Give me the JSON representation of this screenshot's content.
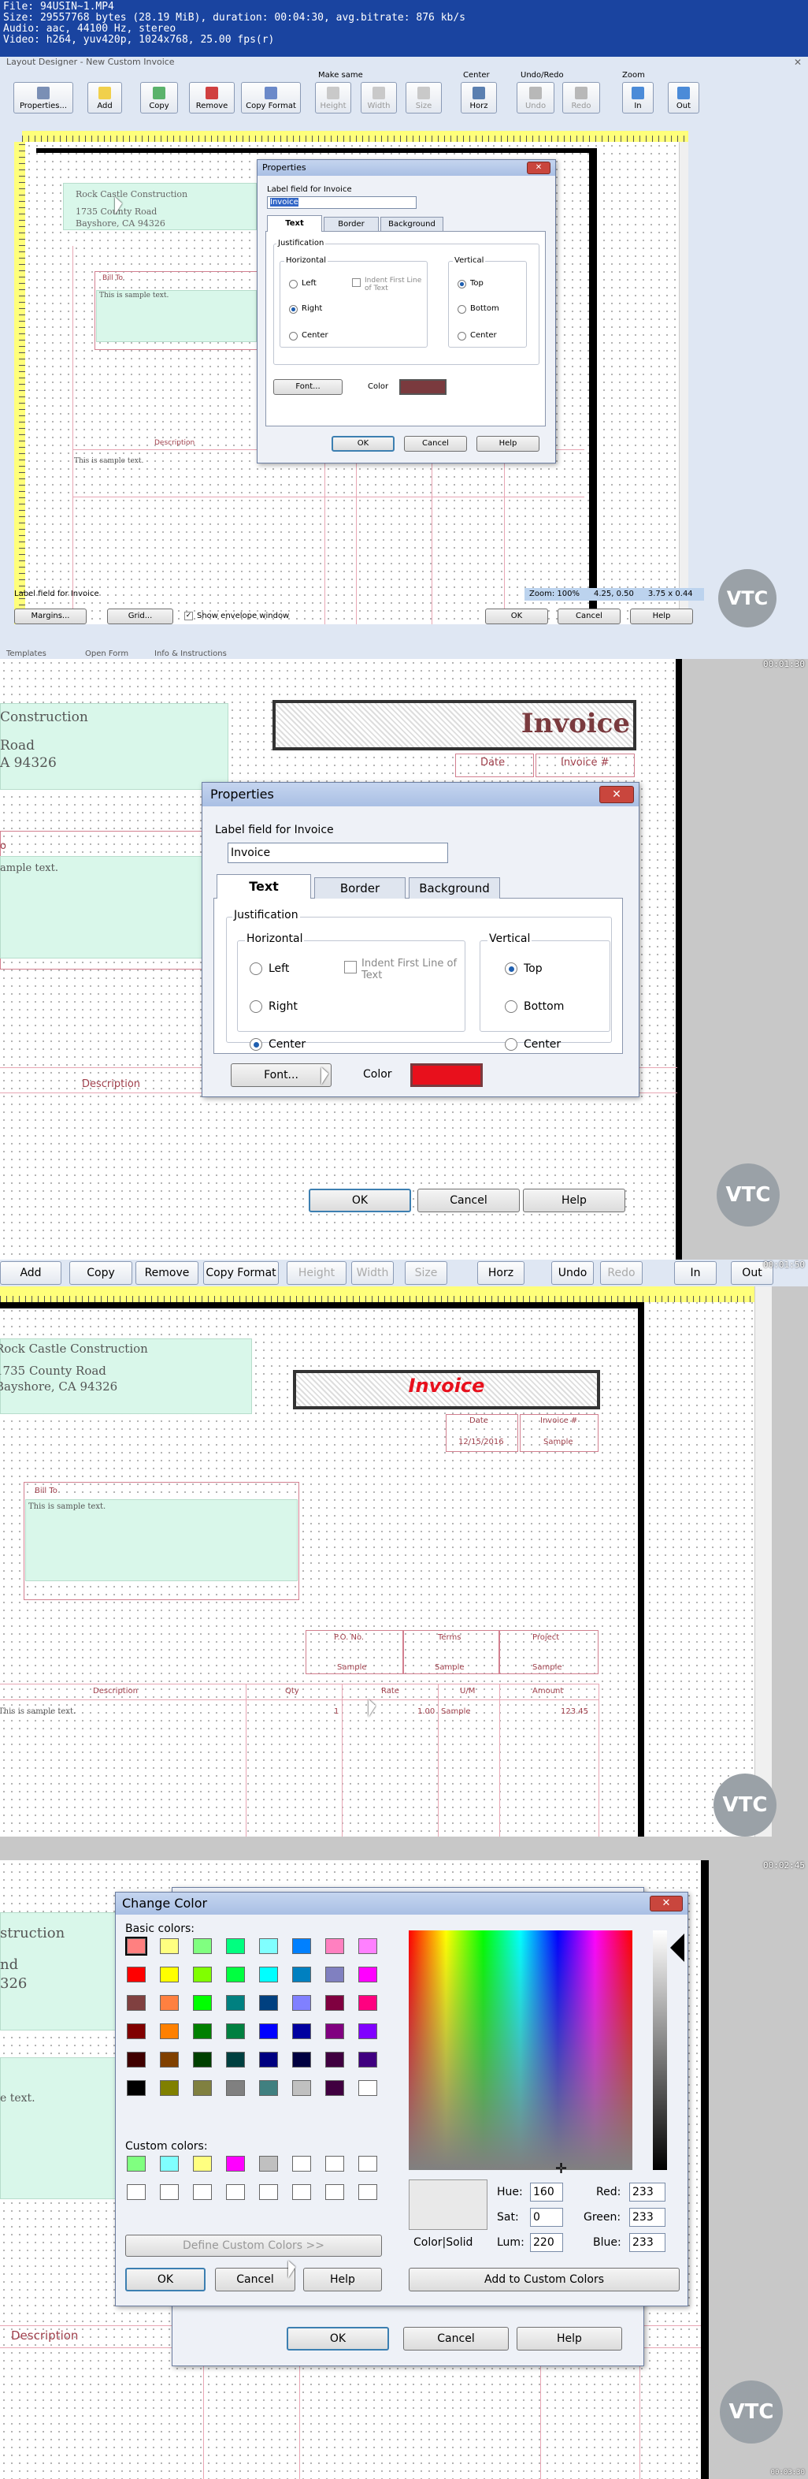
{
  "meta": {
    "line1": "File: 94USIN~1.MP4",
    "line2": "Size: 29557768 bytes (28.19 MiB), duration: 00:04:30, avg.bitrate: 876 kb/s",
    "line3": "Audio: aac, 44100 Hz, stereo",
    "line4": "Video: h264, yuv420p, 1024x768, 25.00 fps(r)"
  },
  "window_title": "Layout Designer - New Custom Invoice",
  "toolbar": {
    "properties": "Properties...",
    "add": "Add",
    "copy": "Copy",
    "remove": "Remove",
    "copy_format": "Copy Format",
    "make_same": "Make same",
    "height": "Height",
    "width": "Width",
    "size": "Size",
    "center": "Center",
    "horz": "Horz",
    "undo_redo": "Undo/Redo",
    "undo": "Undo",
    "redo": "Redo",
    "zoom": "Zoom",
    "in": "In",
    "out": "Out"
  },
  "company": {
    "name": "Rock Castle Construction",
    "addr1": "1735 County Road",
    "addr2": "Bayshore, CA 94326"
  },
  "company_cropped": {
    "name": "Construction",
    "addr1": "Road",
    "addr2": "A 94326",
    "addr1_b": "nd",
    "addr2_b": "326",
    "name_b": "struction"
  },
  "invoice_title": "Invoice",
  "bill_to": "Bill To",
  "bill_to_cropped": "o",
  "sample_text": "This is sample text.",
  "sample_text_cropped": "ample text.",
  "sample_text_cropped_b": "e text.",
  "description": "Description",
  "date": "Date",
  "invoice_num": "Invoice #",
  "status": {
    "label": "Label field for Invoice",
    "zoom": "Zoom: 100%",
    "pos": "4.25, 0.50",
    "size": "3.75 x 0.44"
  },
  "bottom_buttons": {
    "margins": "Margins...",
    "grid": "Grid...",
    "envelope": "Show envelope window",
    "ok": "OK",
    "cancel": "Cancel",
    "help": "Help"
  },
  "props": {
    "title": "Properties",
    "label_field": "Label field for Invoice",
    "value": "Invoice",
    "tab_text": "Text",
    "tab_border": "Border",
    "tab_background": "Background",
    "justification": "Justification",
    "horizontal": "Horizontal",
    "vertical": "Vertical",
    "left": "Left",
    "right": "Right",
    "center": "Center",
    "indent": "Indent First Line of Text",
    "top": "Top",
    "bottom": "Bottom",
    "font": "Font...",
    "color": "Color",
    "ok": "OK",
    "cancel": "Cancel",
    "help": "Help"
  },
  "frame3": {
    "date_val": "12/15/2016",
    "sample": "Sample",
    "po": "P.O. No.",
    "terms": "Terms",
    "project": "Project",
    "qty": "Qty",
    "rate": "Rate",
    "um": "U/M",
    "amount": "Amount",
    "one": "1",
    "rate_val": "1.00",
    "amount_val": "123.45"
  },
  "change_color": {
    "title": "Change Color",
    "basic": "Basic colors:",
    "custom": "Custom colors:",
    "define": "Define Custom Colors >>",
    "ok": "OK",
    "cancel": "Cancel",
    "help": "Help",
    "color_solid": "Color|Solid",
    "hue_l": "Hue:",
    "sat_l": "Sat:",
    "lum_l": "Lum:",
    "red_l": "Red:",
    "green_l": "Green:",
    "blue_l": "Blue:",
    "hue": "160",
    "sat": "0",
    "lum": "220",
    "red": "233",
    "green": "233",
    "blue": "233",
    "add_custom": "Add to Custom Colors"
  },
  "timestamps": {
    "f2": "00:01:30",
    "f3": "00:01:50",
    "f4": "00:02:45",
    "f5": "00:03:30"
  },
  "bg_tabs": {
    "templates": "Templates",
    "open_form": "Open Form",
    "info": "Info & Instructions"
  },
  "vtc": "VTC",
  "colors": {
    "invoice_red_dark": "#7a3a3e",
    "invoice_red": "#e8101c",
    "title_bar": "#1a44a0"
  },
  "basic_colors": [
    "#ff8080",
    "#ffff80",
    "#80ff80",
    "#00ff80",
    "#80ffff",
    "#0080ff",
    "#ff80c0",
    "#ff80ff",
    "#ff0000",
    "#ffff00",
    "#80ff00",
    "#00ff40",
    "#00ffff",
    "#0080c0",
    "#8080c0",
    "#ff00ff",
    "#804040",
    "#ff8040",
    "#00ff00",
    "#008080",
    "#004080",
    "#8080ff",
    "#800040",
    "#ff0080",
    "#800000",
    "#ff8000",
    "#008000",
    "#008040",
    "#0000ff",
    "#0000a0",
    "#800080",
    "#8000ff",
    "#400000",
    "#804000",
    "#004000",
    "#004040",
    "#000080",
    "#000040",
    "#400040",
    "#400080",
    "#000000",
    "#808000",
    "#808040",
    "#808080",
    "#408080",
    "#c0c0c0",
    "#400040",
    "#ffffff"
  ],
  "custom_colors": [
    "#80ff80",
    "#80ffff",
    "#ffff80",
    "#ff00ff",
    "#c0c0c0",
    "#ffffff",
    "#ffffff",
    "#ffffff",
    "#ffffff",
    "#ffffff",
    "#ffffff",
    "#ffffff",
    "#ffffff",
    "#ffffff",
    "#ffffff",
    "#ffffff"
  ]
}
